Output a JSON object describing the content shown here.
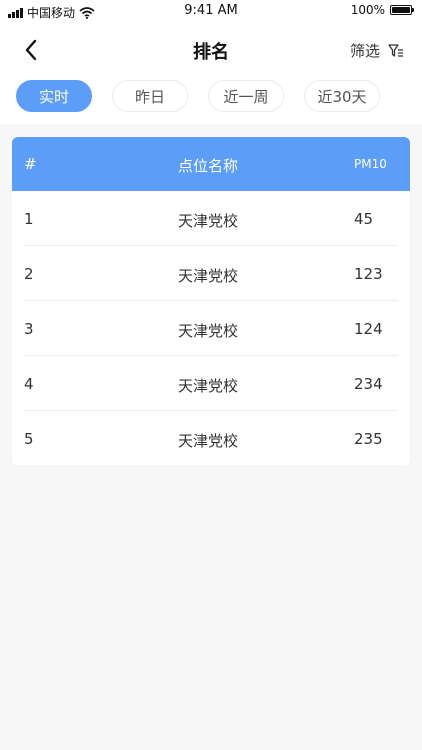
{
  "status_bar": {
    "carrier": "中国移动",
    "time": "9:41 AM",
    "battery": "100%",
    "battery_level": 1.0
  },
  "nav": {
    "title": "排名",
    "filter_label": "筛选"
  },
  "tabs": [
    {
      "label": "实时",
      "active": true
    },
    {
      "label": "昨日",
      "active": false
    },
    {
      "label": "近一周",
      "active": false
    },
    {
      "label": "近30天",
      "active": false
    }
  ],
  "table": {
    "headers": {
      "rank": "#",
      "name": "点位名称",
      "pm": "PM10"
    },
    "rows": [
      {
        "rank": "1",
        "name": "天津党校",
        "pm": "45"
      },
      {
        "rank": "2",
        "name": "天津党校",
        "pm": "123"
      },
      {
        "rank": "3",
        "name": "天津党校",
        "pm": "124"
      },
      {
        "rank": "4",
        "name": "天津党校",
        "pm": "234"
      },
      {
        "rank": "5",
        "name": "天津党校",
        "pm": "235"
      }
    ]
  },
  "colors": {
    "accent": "#5b9df7",
    "background": "#f7f7f8"
  },
  "icons": {
    "back": "chevron-left-icon",
    "filter": "filter-icon",
    "wifi": "wifi-icon",
    "signal": "signal-icon",
    "battery": "battery-icon"
  }
}
